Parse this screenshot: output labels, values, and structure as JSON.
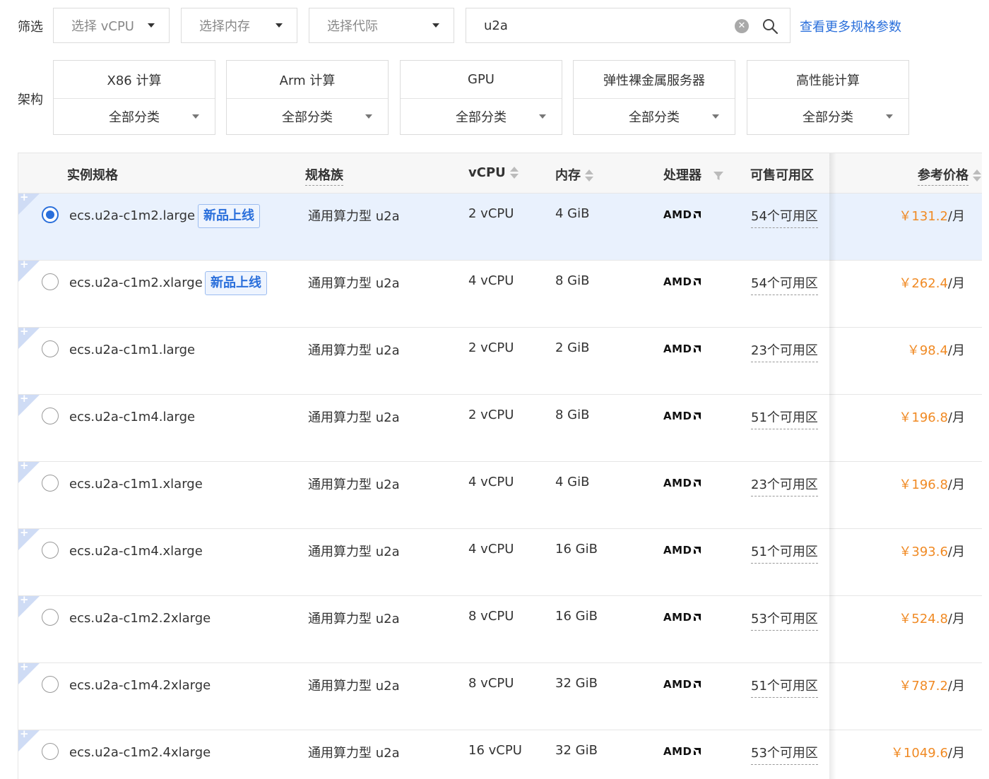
{
  "filter": {
    "label": "筛选",
    "vcpu_select": "选择 vCPU",
    "memory_select": "选择内存",
    "generation_select": "选择代际",
    "search_value": "u2a",
    "clear_icon": "clear-icon",
    "search_icon": "search-icon",
    "more_link": "查看更多规格参数"
  },
  "arch": {
    "label": "架构",
    "cards": [
      {
        "title": "X86 计算",
        "select": "全部分类"
      },
      {
        "title": "Arm 计算",
        "select": "全部分类"
      },
      {
        "title": "GPU",
        "select": "全部分类"
      },
      {
        "title": "弹性裸金属服务器",
        "select": "全部分类"
      },
      {
        "title": "高性能计算",
        "select": "全部分类"
      }
    ]
  },
  "table": {
    "headers": {
      "spec": "实例规格",
      "family": "规格族",
      "vcpu": "vCPU",
      "memory": "内存",
      "processor": "处理器",
      "zones": "可售可用区",
      "price": "参考价格"
    },
    "new_tag": "新品上线",
    "price_unit": "/月",
    "rows": [
      {
        "spec": "ecs.u2a-c1m2.large",
        "is_new": true,
        "selected": true,
        "family": "通用算力型 u2a",
        "vcpu": "2 vCPU",
        "memory": "4 GiB",
        "processor": "AMD",
        "zones": "54个可用区",
        "price": "￥131.2"
      },
      {
        "spec": "ecs.u2a-c1m2.xlarge",
        "is_new": true,
        "selected": false,
        "family": "通用算力型 u2a",
        "vcpu": "4 vCPU",
        "memory": "8 GiB",
        "processor": "AMD",
        "zones": "54个可用区",
        "price": "￥262.4"
      },
      {
        "spec": "ecs.u2a-c1m1.large",
        "is_new": false,
        "selected": false,
        "family": "通用算力型 u2a",
        "vcpu": "2 vCPU",
        "memory": "2 GiB",
        "processor": "AMD",
        "zones": "23个可用区",
        "price": "￥98.4"
      },
      {
        "spec": "ecs.u2a-c1m4.large",
        "is_new": false,
        "selected": false,
        "family": "通用算力型 u2a",
        "vcpu": "2 vCPU",
        "memory": "8 GiB",
        "processor": "AMD",
        "zones": "51个可用区",
        "price": "￥196.8"
      },
      {
        "spec": "ecs.u2a-c1m1.xlarge",
        "is_new": false,
        "selected": false,
        "family": "通用算力型 u2a",
        "vcpu": "4 vCPU",
        "memory": "4 GiB",
        "processor": "AMD",
        "zones": "23个可用区",
        "price": "￥196.8"
      },
      {
        "spec": "ecs.u2a-c1m4.xlarge",
        "is_new": false,
        "selected": false,
        "family": "通用算力型 u2a",
        "vcpu": "4 vCPU",
        "memory": "16 GiB",
        "processor": "AMD",
        "zones": "51个可用区",
        "price": "￥393.6"
      },
      {
        "spec": "ecs.u2a-c1m2.2xlarge",
        "is_new": false,
        "selected": false,
        "family": "通用算力型 u2a",
        "vcpu": "8 vCPU",
        "memory": "16 GiB",
        "processor": "AMD",
        "zones": "53个可用区",
        "price": "￥524.8"
      },
      {
        "spec": "ecs.u2a-c1m4.2xlarge",
        "is_new": false,
        "selected": false,
        "family": "通用算力型 u2a",
        "vcpu": "8 vCPU",
        "memory": "32 GiB",
        "processor": "AMD",
        "zones": "51个可用区",
        "price": "￥787.2"
      },
      {
        "spec": "ecs.u2a-c1m2.4xlarge",
        "is_new": false,
        "selected": false,
        "family": "通用算力型 u2a",
        "vcpu": "16 vCPU",
        "memory": "32 GiB",
        "processor": "AMD",
        "zones": "53个可用区",
        "price": "￥1049.6"
      }
    ]
  },
  "colors": {
    "accent": "#2a6fdb",
    "price": "#f08a24",
    "selected_row": "#e9f1fd"
  }
}
